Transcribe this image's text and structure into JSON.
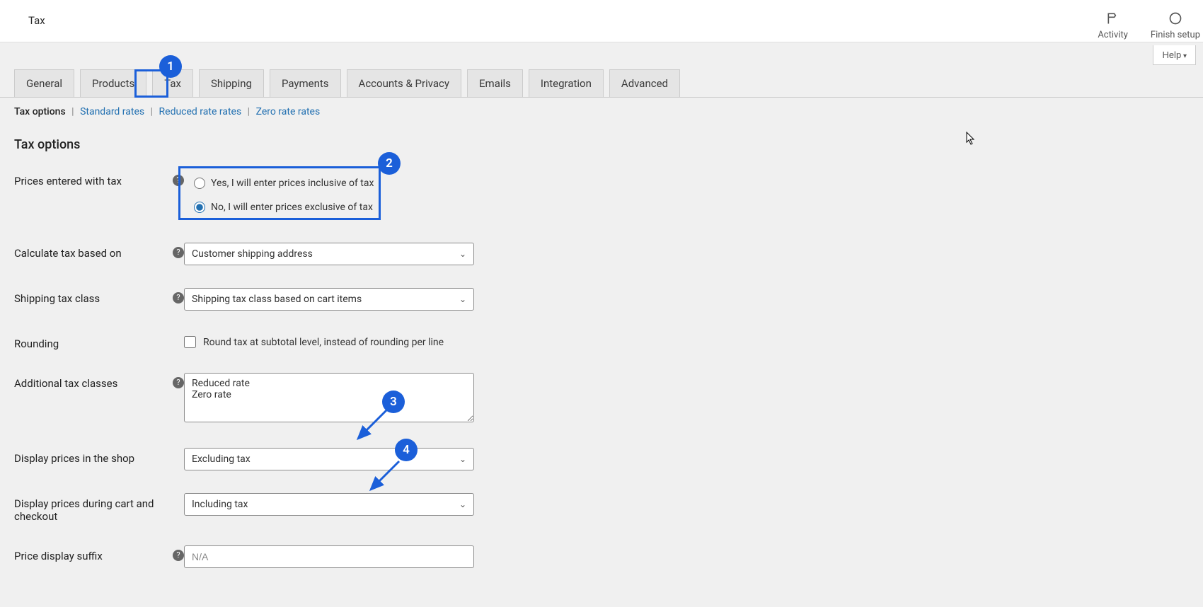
{
  "header": {
    "title": "Tax",
    "activity_label": "Activity",
    "finish_setup_label": "Finish setup"
  },
  "help_button": "Help",
  "tabs": {
    "general": "General",
    "products": "Products",
    "tax": "Tax",
    "shipping": "Shipping",
    "payments": "Payments",
    "accounts": "Accounts & Privacy",
    "emails": "Emails",
    "integration": "Integration",
    "advanced": "Advanced"
  },
  "subnav": {
    "tax_options": "Tax options",
    "standard_rates": "Standard rates",
    "reduced_rate_rates": "Reduced rate rates",
    "zero_rate_rates": "Zero rate rates"
  },
  "section_heading": "Tax options",
  "fields": {
    "prices_with_tax": {
      "label": "Prices entered with tax",
      "opt_yes": "Yes, I will enter prices inclusive of tax",
      "opt_no": "No, I will enter prices exclusive of tax"
    },
    "calc_tax": {
      "label": "Calculate tax based on",
      "value": "Customer shipping address"
    },
    "shipping_tax_class": {
      "label": "Shipping tax class",
      "value": "Shipping tax class based on cart items"
    },
    "rounding": {
      "label": "Rounding",
      "checkbox_label": "Round tax at subtotal level, instead of rounding per line"
    },
    "additional_classes": {
      "label": "Additional tax classes",
      "value": "Reduced rate\nZero rate"
    },
    "display_shop": {
      "label": "Display prices in the shop",
      "value": "Excluding tax"
    },
    "display_cart": {
      "label": "Display prices during cart and checkout",
      "value": "Including tax"
    },
    "suffix": {
      "label": "Price display suffix",
      "placeholder": "N/A"
    }
  },
  "annotations": {
    "b1": "1",
    "b2": "2",
    "b3": "3",
    "b4": "4"
  }
}
